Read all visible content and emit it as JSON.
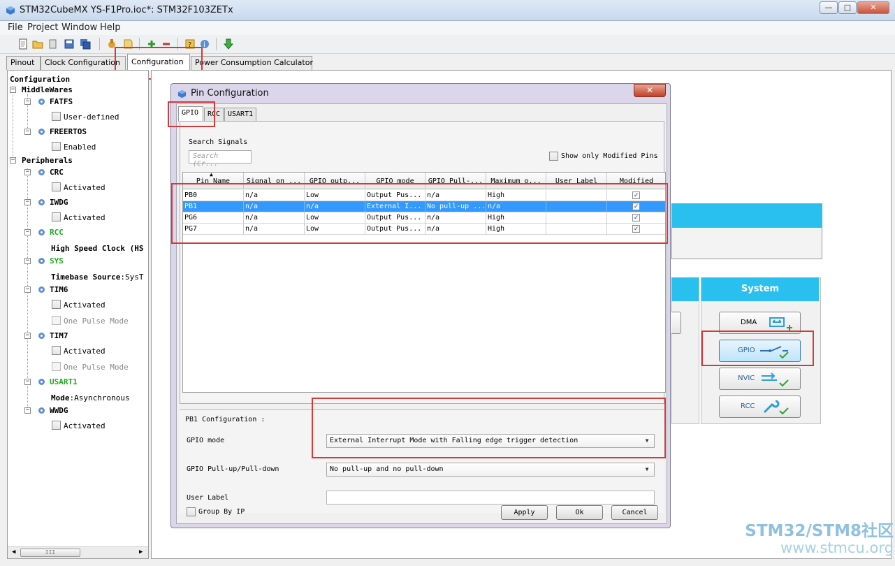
{
  "window": {
    "title": "STM32CubeMX YS-F1Pro.ioc*: STM32F103ZETx",
    "minimize": "—",
    "maximize": "□",
    "close": "✕"
  },
  "menu": [
    "File",
    "Project",
    "Window",
    "Help"
  ],
  "main_tabs": [
    "Pinout",
    "Clock Configuration",
    "Configuration",
    "Power Consumption Calculator"
  ],
  "tree": {
    "root": "Configuration",
    "middlewares_label": "MiddleWares",
    "fatfs": {
      "name": "FATFS",
      "option": "User-defined"
    },
    "freertos": {
      "name": "FREERTOS",
      "option": "Enabled"
    },
    "peripherals_label": "Peripherals",
    "crc": {
      "name": "CRC",
      "option": "Activated"
    },
    "iwdg": {
      "name": "IWDG",
      "option": "Activated"
    },
    "rcc": {
      "name": "RCC",
      "option": "High Speed Clock (HS"
    },
    "sys": {
      "name": "SYS",
      "option_key": "Timebase Source",
      "option_val": ":SysT"
    },
    "tim6": {
      "name": "TIM6",
      "option1": "Activated",
      "option2": "One Pulse Mode"
    },
    "tim7": {
      "name": "TIM7",
      "option1": "Activated",
      "option2": "One Pulse Mode"
    },
    "usart1": {
      "name": "USART1",
      "option_key": "Mode",
      "option_val": ":Asynchronous"
    },
    "wwdg": {
      "name": "WWDG",
      "option": "Activated"
    },
    "scroll_thumb": "III"
  },
  "right": {
    "system_header": "System",
    "buttons": {
      "dma": "DMA",
      "gpio": "GPIO",
      "nvic": "NVIC",
      "rcc": "RCC"
    }
  },
  "dialog": {
    "title": "Pin Configuration",
    "close": "✕",
    "tabs": [
      "GPIO",
      "RCC",
      "USART1"
    ],
    "search_label": "Search Signals",
    "search_placeholder": "Search (Cr...",
    "show_modified_label": "Show only Modified Pins",
    "columns": [
      "Pin Name",
      "Signal on ...",
      "GPIO outp...",
      "GPIO mode",
      "GPIO Pull-...",
      "Maximum o...",
      "User Label",
      "Modified"
    ],
    "rows": [
      {
        "pin": "PB0",
        "signal": "n/a",
        "output": "Low",
        "mode": "Output Pus...",
        "pull": "n/a",
        "speed": "High",
        "label": "",
        "modified": "✓"
      },
      {
        "pin": "PB1",
        "signal": "n/a",
        "output": "n/a",
        "mode": "External I...",
        "pull": "No pull-up ...",
        "speed": "n/a",
        "label": "",
        "modified": "✓"
      },
      {
        "pin": "PG6",
        "signal": "n/a",
        "output": "Low",
        "mode": "Output Pus...",
        "pull": "n/a",
        "speed": "High",
        "label": "",
        "modified": "✓"
      },
      {
        "pin": "PG7",
        "signal": "n/a",
        "output": "Low",
        "mode": "Output Pus...",
        "pull": "n/a",
        "speed": "High",
        "label": "",
        "modified": "✓"
      }
    ],
    "config": {
      "title": "PB1 Configuration :",
      "mode_label": "GPIO mode",
      "mode_value": "External Interrupt Mode with Falling edge trigger detection",
      "pull_label": "GPIO Pull-up/Pull-down",
      "pull_value": "No pull-up and no pull-down",
      "user_label": "User Label",
      "user_label_value": ""
    },
    "group_by_ip": "Group By IP",
    "apply": "Apply",
    "ok": "Ok",
    "cancel": "Cancel"
  },
  "watermark": {
    "line1": "STM32/STM8社区",
    "line2": "www.stmcu.org"
  }
}
